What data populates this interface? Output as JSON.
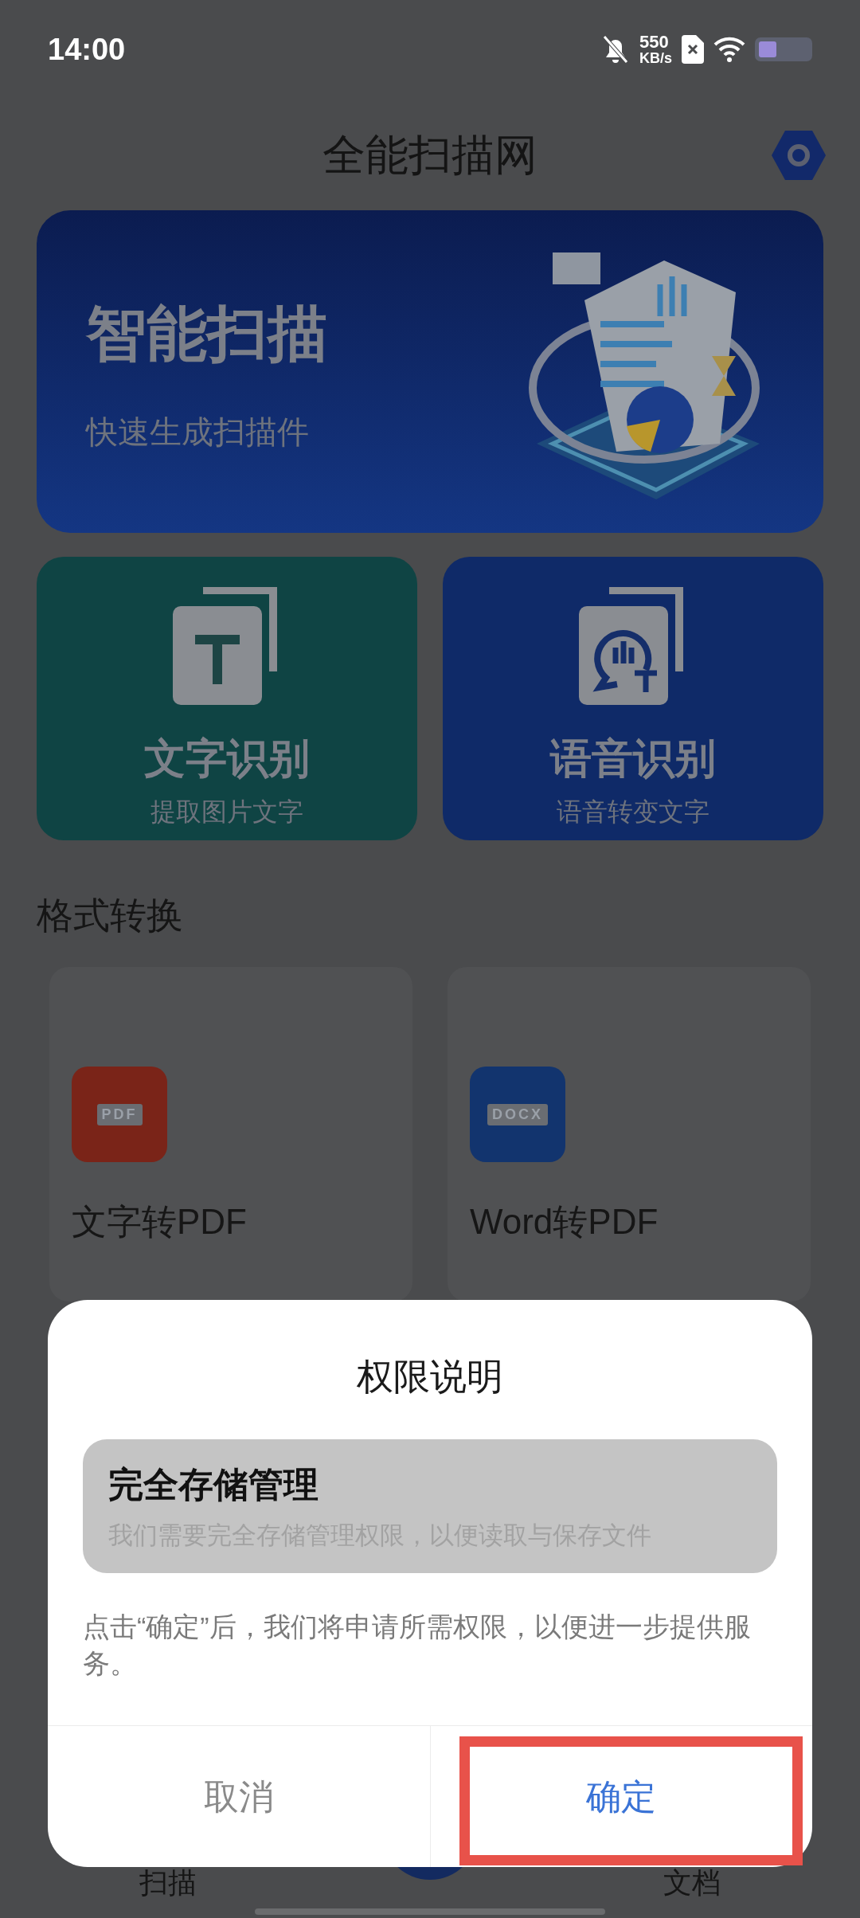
{
  "status_bar": {
    "time": "14:00",
    "net_speed": "550",
    "net_unit": "KB/s"
  },
  "header": {
    "title": "全能扫描网"
  },
  "hero": {
    "title": "智能扫描",
    "subtitle": "快速生成扫描件"
  },
  "features": [
    {
      "kind": "text",
      "title": "文字识别",
      "subtitle": "提取图片文字",
      "color": "#0f4444"
    },
    {
      "kind": "voice",
      "title": "语音识别",
      "subtitle": "语音转变文字",
      "color": "#0f2a68"
    }
  ],
  "section_title": "格式转换",
  "format_items": [
    {
      "label": "文字转PDF",
      "badge": "PDF",
      "color": "#7a2418"
    },
    {
      "label": "Word转PDF",
      "badge": "DOCX",
      "color": "#12346e"
    }
  ],
  "bottom_nav": [
    {
      "label": "扫描"
    },
    {
      "label": "文档"
    }
  ],
  "dialog": {
    "title": "权限说明",
    "permission": {
      "name": "完全存储管理",
      "description": "我们需要完全存储管理权限，以便读取与保存文件"
    },
    "note": "点击“确定”后，我们将申请所需权限，以便进一步提供服务。",
    "buttons": [
      {
        "label": "取消",
        "kind": "cancel",
        "highlighted": false
      },
      {
        "label": "确定",
        "kind": "confirm",
        "highlighted": true
      }
    ]
  }
}
